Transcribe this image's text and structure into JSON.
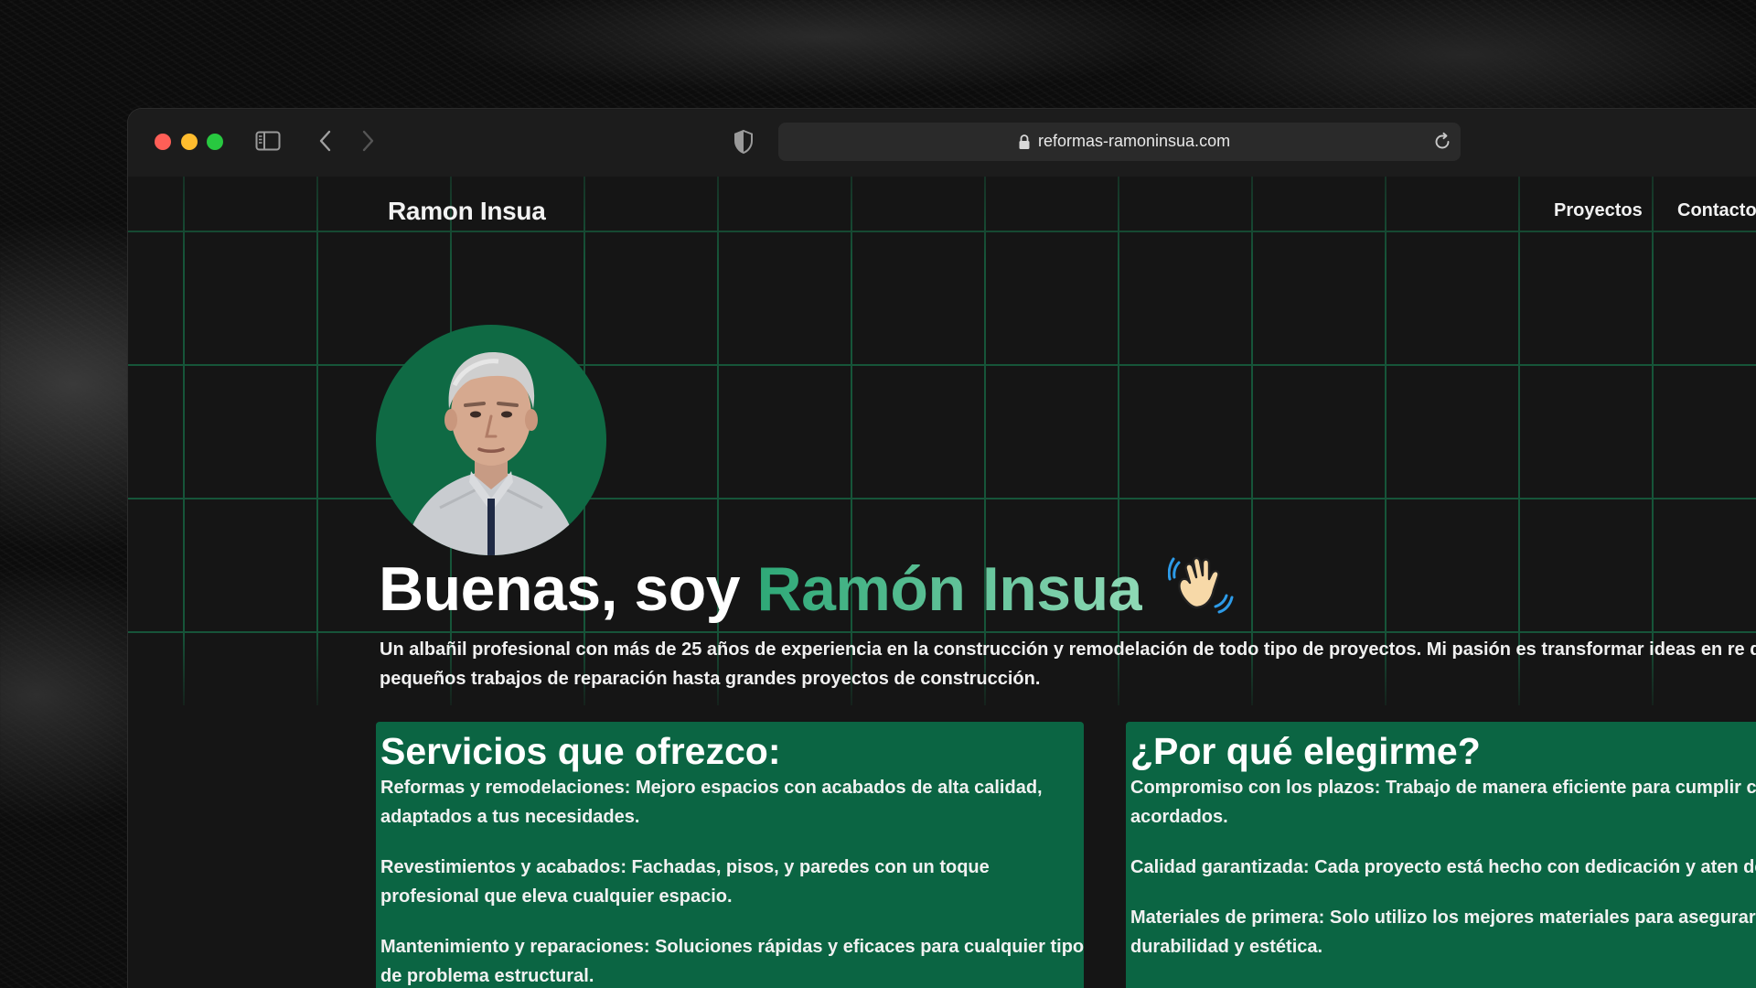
{
  "browser": {
    "url": "reformas-ramoninsua.com",
    "icons": [
      "sidebar-icon",
      "back-icon",
      "forward-icon",
      "shield-icon",
      "lock-icon",
      "reload-icon"
    ]
  },
  "nav": {
    "brand": "Ramon Insua",
    "links": [
      "Proyectos",
      "Contacto"
    ]
  },
  "hero": {
    "greeting": "Buenas, soy ",
    "name": "Ramón Insua",
    "emoji": "waving-hand",
    "intro": "Un albañil profesional con más de 25 años de experiencia en la construcción y remodelación de todo tipo de proyectos. Mi pasión es transformar ideas en re desde pequeños trabajos de reparación hasta grandes proyectos de construcción."
  },
  "services": {
    "title": "Servicios que ofrezco:",
    "items": [
      "Reformas y remodelaciones: Mejoro espacios con acabados de alta calidad, adaptados a tus necesidades.",
      "Revestimientos y acabados: Fachadas, pisos, y paredes con un toque profesional que eleva cualquier espacio.",
      "Mantenimiento y reparaciones: Soluciones rápidas y eficaces para cualquier tipo de problema estructural."
    ]
  },
  "why": {
    "title": "¿Por qué elegirme?",
    "items": [
      "Compromiso con los plazos: Trabajo de manera eficiente para cumplir c tiempos acordados.",
      "Calidad garantizada: Cada proyecto está hecho con dedicación y aten detalle.",
      "Materiales de primera: Solo utilizo los mejores materiales para asegurar durabilidad y estética."
    ]
  },
  "colors": {
    "accent_green": "#0b6543",
    "grid_line": "#175c3e",
    "name_gradient_start": "#2ea877",
    "name_gradient_end": "#8fd9b6"
  }
}
